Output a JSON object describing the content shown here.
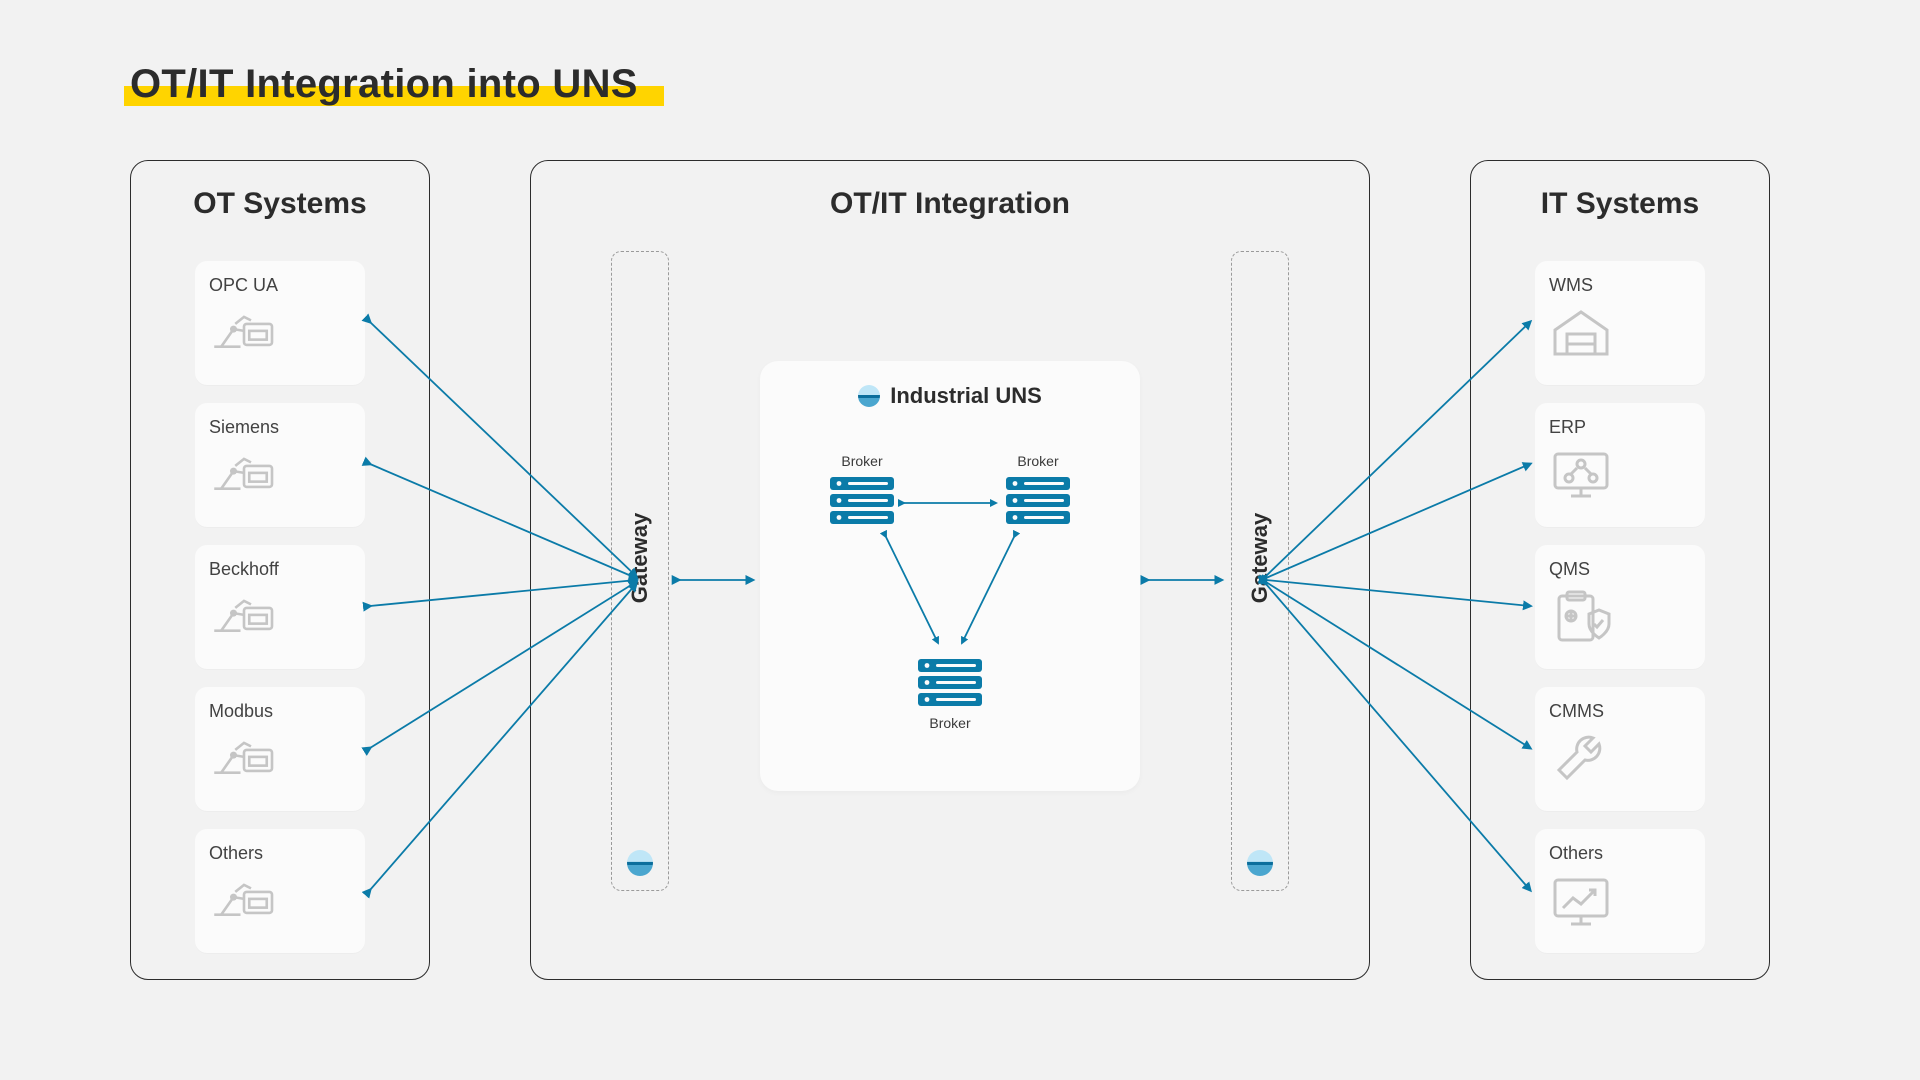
{
  "title": "OT/IT Integration into UNS",
  "panels": {
    "ot": {
      "title": "OT Systems",
      "items": [
        "OPC UA",
        "Siemens",
        "Beckhoff",
        "Modbus",
        "Others"
      ]
    },
    "mid": {
      "title": "OT/IT Integration",
      "gateway_label": "Gateway"
    },
    "it": {
      "title": "IT Systems",
      "items": [
        "WMS",
        "ERP",
        "QMS",
        "CMMS",
        "Others"
      ]
    }
  },
  "uns": {
    "title": "Industrial UNS",
    "broker_label": "Broker"
  },
  "colors": {
    "arrow": "#0b7ba8",
    "server": "#0b7ba8",
    "muted": "#bfbfbf"
  }
}
